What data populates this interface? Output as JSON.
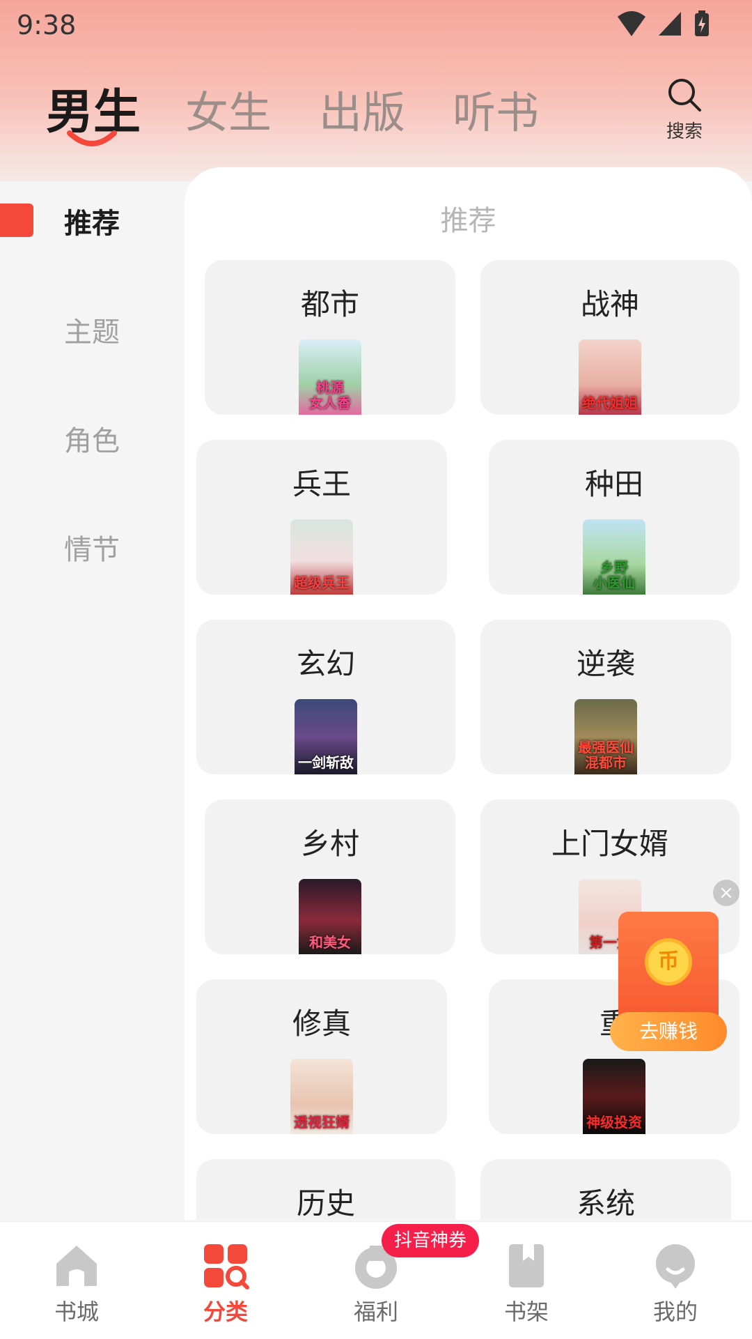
{
  "status_bar": {
    "time": "9:38"
  },
  "top_tabs": [
    {
      "label": "男生",
      "active": true
    },
    {
      "label": "女生",
      "active": false
    },
    {
      "label": "出版",
      "active": false
    },
    {
      "label": "听书",
      "active": false
    }
  ],
  "search": {
    "label": "搜索",
    "icon": "search-icon"
  },
  "sidebar": {
    "items": [
      {
        "label": "推荐",
        "active": true
      },
      {
        "label": "主题",
        "active": false
      },
      {
        "label": "角色",
        "active": false
      },
      {
        "label": "情节",
        "active": false
      }
    ]
  },
  "main": {
    "section_title": "推荐",
    "categories": [
      {
        "label": "都市",
        "cover_text": "桃源\n女人香"
      },
      {
        "label": "战神",
        "cover_text": "绝代姐姐"
      },
      {
        "label": "兵王",
        "cover_text": "超级兵王"
      },
      {
        "label": "种田",
        "cover_text": "乡野\n小医仙"
      },
      {
        "label": "玄幻",
        "cover_text": "一剑斩敌"
      },
      {
        "label": "逆袭",
        "cover_text": "最强医仙\n混都市"
      },
      {
        "label": "乡村",
        "cover_text": "和美女"
      },
      {
        "label": "上门女婿",
        "cover_text": "第一女"
      },
      {
        "label": "修真",
        "cover_text": "透视狂婿"
      },
      {
        "label": "重",
        "cover_text": "神级投资"
      },
      {
        "label": "历史",
        "cover_text": ""
      },
      {
        "label": "系统",
        "cover_text": ""
      }
    ]
  },
  "floating_ad": {
    "close": "×",
    "coin": "币",
    "button": "去赚钱"
  },
  "bottom_nav": {
    "items": [
      {
        "label": "书城",
        "icon": "home-icon",
        "active": false
      },
      {
        "label": "分类",
        "icon": "category-grid-icon",
        "active": true
      },
      {
        "label": "福利",
        "icon": "gift-icon",
        "active": false
      },
      {
        "label": "书架",
        "icon": "bookshelf-icon",
        "active": false
      },
      {
        "label": "我的",
        "icon": "profile-icon",
        "active": false
      }
    ],
    "badge": "抖音神券"
  },
  "colors": {
    "accent": "#f4483a",
    "badge": "#f51f4a",
    "header_top": "#f6a59a"
  }
}
